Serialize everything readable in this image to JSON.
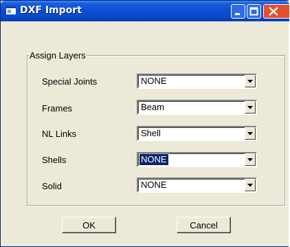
{
  "window": {
    "title": "DXF Import"
  },
  "group": {
    "title": "Assign Layers"
  },
  "rows": [
    {
      "label": "Special Joints",
      "value": "NONE"
    },
    {
      "label": "Frames",
      "value": "Beam"
    },
    {
      "label": "NL Links",
      "value": "Shell"
    },
    {
      "label": "Shells",
      "value": "NONE"
    },
    {
      "label": "Solid",
      "value": "NONE"
    }
  ],
  "buttons": {
    "ok": "OK",
    "cancel": "Cancel"
  },
  "colors": {
    "titlebar": "#0b4fd6",
    "dialog": "#ece9d8",
    "selection": "#0a246a",
    "close": "#e2502a"
  }
}
